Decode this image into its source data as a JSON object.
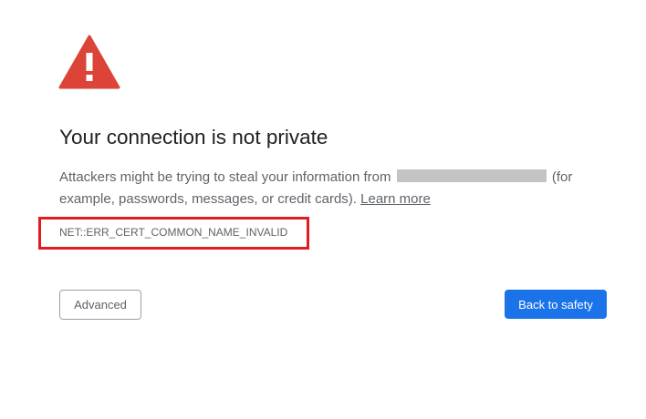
{
  "icon": {
    "name": "warning-triangle-icon",
    "color": "#db4437"
  },
  "title": "Your connection is not private",
  "message": {
    "before": "Attackers might be trying to steal your information from",
    "after": "(for example, passwords, messages, or credit cards).",
    "learn_more": "Learn more"
  },
  "error_code": "NET::ERR_CERT_COMMON_NAME_INVALID",
  "highlight_color": "#e31b23",
  "buttons": {
    "advanced": "Advanced",
    "back": "Back to safety"
  },
  "colors": {
    "primary_button": "#1a73e8",
    "title": "#202124",
    "body_text": "#5f6368"
  }
}
